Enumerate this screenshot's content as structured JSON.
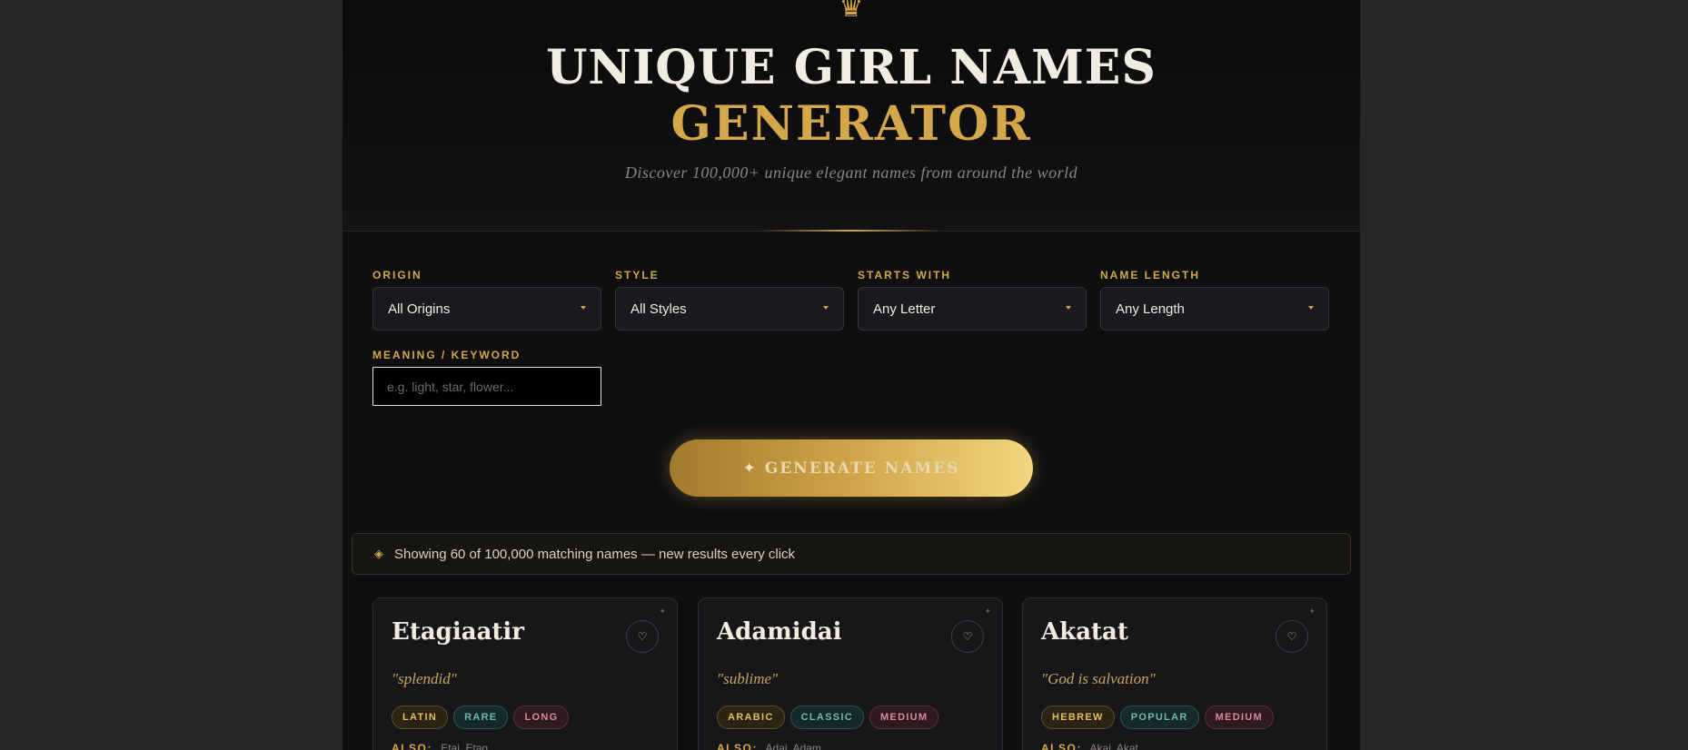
{
  "hero": {
    "crown_icon": "♛",
    "title_line1": "UNIQUE GIRL NAMES",
    "title_line2": "GENERATOR",
    "subtitle": "Discover 100,000+ unique elegant names from around the world"
  },
  "filters": {
    "origin": {
      "label": "ORIGIN",
      "value": "All Origins"
    },
    "style": {
      "label": "STYLE",
      "value": "All Styles"
    },
    "starts_with": {
      "label": "STARTS WITH",
      "value": "Any Letter"
    },
    "name_length": {
      "label": "NAME LENGTH",
      "value": "Any Length"
    },
    "keyword": {
      "label": "MEANING / KEYWORD",
      "value": "",
      "placeholder": "e.g. light, star, flower..."
    }
  },
  "generate_button": {
    "icon": "✦",
    "label": "GENERATE NAMES"
  },
  "status": {
    "icon": "◈",
    "text": "Showing 60 of 100,000 matching names — new results every click"
  },
  "cards": [
    {
      "name": "Etagiaatir",
      "meaning": "\"splendid\"",
      "tags": [
        "LATIN",
        "RARE",
        "LONG"
      ],
      "also_label": "ALSO:",
      "also_value": "Etai, Etag"
    },
    {
      "name": "Adamidai",
      "meaning": "\"sublime\"",
      "tags": [
        "ARABIC",
        "CLASSIC",
        "MEDIUM"
      ],
      "also_label": "ALSO:",
      "also_value": "Adai, Adam"
    },
    {
      "name": "Akatat",
      "meaning": "\"God is salvation\"",
      "tags": [
        "HEBREW",
        "POPULAR",
        "MEDIUM"
      ],
      "also_label": "ALSO:",
      "also_value": "Akai, Akat"
    }
  ],
  "card_decor": {
    "star_icon": "✦",
    "heart_icon": "♡"
  },
  "colors": {
    "accent_gold": "#d4a84a",
    "page_bg": "#0f0f10",
    "outer_bg": "#262626",
    "tag_origin": "#e3bd5e",
    "tag_style": "#6fb9b5",
    "tag_length": "#d98a98"
  }
}
